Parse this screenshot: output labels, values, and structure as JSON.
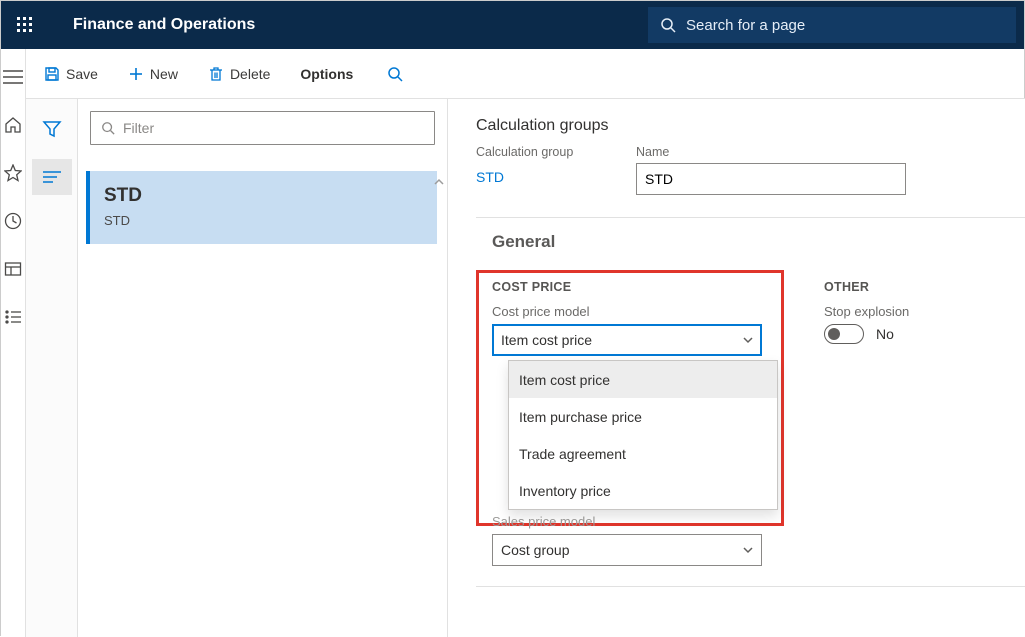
{
  "header": {
    "app_title": "Finance and Operations",
    "search_placeholder": "Search for a page"
  },
  "action_bar": {
    "save": "Save",
    "new": "New",
    "delete": "Delete",
    "options": "Options"
  },
  "list": {
    "filter_placeholder": "Filter",
    "selected": {
      "title": "STD",
      "subtitle": "STD"
    }
  },
  "detail": {
    "page_title": "Calculation groups",
    "calc_group_label": "Calculation group",
    "calc_group_value": "STD",
    "name_label": "Name",
    "name_value": "STD",
    "fasttab_general": "General",
    "cost_price": {
      "section_title": "COST PRICE",
      "model_label": "Cost price model",
      "model_value": "Item cost price",
      "options": [
        "Item cost price",
        "Item purchase price",
        "Trade agreement",
        "Inventory price"
      ],
      "sales_model_label": "Sales price model",
      "sales_model_value": "Cost group"
    },
    "other": {
      "section_title": "OTHER",
      "stop_explosion_label": "Stop explosion",
      "stop_explosion_value": "No"
    }
  }
}
